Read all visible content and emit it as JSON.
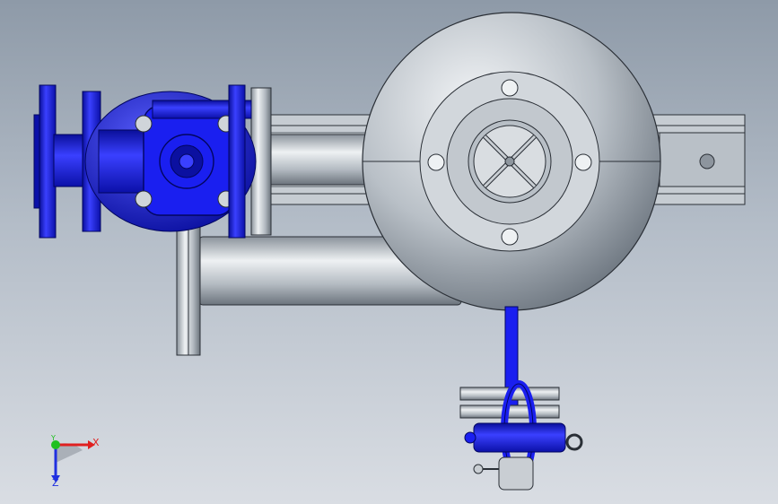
{
  "viewport": {
    "background_top": "#8e9aa8",
    "background_bottom": "#d9dde3"
  },
  "model": {
    "valve_color": "#1a1ff0",
    "steel_color": "#c9ced3",
    "outline_color": "#2a2f36"
  },
  "triad": {
    "x_label": "X",
    "y_label": "Y",
    "z_label": "Z",
    "x_color": "#e02020",
    "y_color": "#20c020",
    "z_color": "#2030e0"
  }
}
